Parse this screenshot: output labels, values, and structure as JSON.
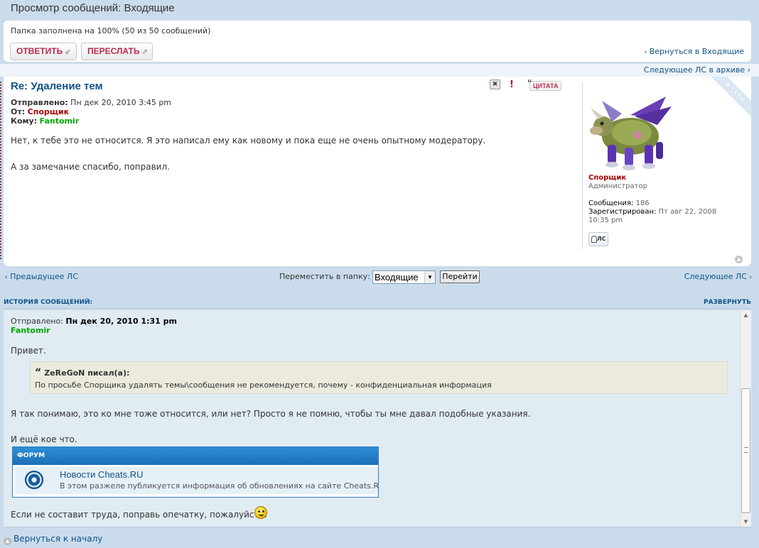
{
  "header": {
    "title": "Просмотр сообщений: Входящие"
  },
  "top_panel": {
    "folder_status": "Папка заполнена на 100% (50 из 50 сообщений)",
    "reply_label": "ОТВЕТИТЬ",
    "forward_label": "ПЕРЕСЛАТЬ",
    "back_arrow": "‹",
    "back_label": "Вернуться в Входящие"
  },
  "archive": {
    "label": "Следующее ЛС в архиве",
    "arrow": "›"
  },
  "message": {
    "subject": "Re: Удаление тем",
    "sent_label": "Отправлено:",
    "sent_value": "Пн дек 20, 2010 3:45 pm",
    "from_label": "От:",
    "from_value": "Спорщик",
    "to_label": "Кому:",
    "to_value": "Fantomir",
    "text1": "Нет, к тебе это не относится. Я это написал ему как новому и пока еще не очень опытному модератору.",
    "text2": "А за замечание спасибо, поправил.",
    "tools": {
      "delete_glyph": "✖",
      "report_glyph": "!",
      "quote_label": "ЦИТАТА",
      "quote_glyph": "“"
    },
    "online_label": "В СЕТИ"
  },
  "profile": {
    "username": "Спорщик",
    "rank": "Администратор",
    "posts_label": "Сообщения:",
    "posts_value": "186",
    "registered_label": "Зарегистрирован:",
    "registered_value": "Пт авг 22, 2008",
    "registered_time": "10:35 pm",
    "pm_label": "ЛС"
  },
  "nav": {
    "prev_label": "Предыдущее ЛС",
    "next_label": "Следующее ЛС",
    "prev_arrow": "‹",
    "next_arrow": "›",
    "move_label": "Переместить в папку:",
    "folder_selected": "Входящие",
    "go_label": "Перейти"
  },
  "history": {
    "title": "ИСТОРИЯ СООБЩЕНИЙ:",
    "expand_label": "РАЗВЕРНУТЬ",
    "sent_label": "Отправлено:",
    "sent_value": "Пн дек 20, 2010 1:31 pm",
    "author": "Fantomir",
    "greeting": "Привет.",
    "quote_author": "ZeReGoN писал(а):",
    "quote_text": "По просьбе Спорщика удалять темы\\сообщения не рекомендуется, почему - конфиденциальная информация",
    "text1": "Я так понимаю, это ко мне тоже относится, или нет? Просто я не помню, чтобы ты мне давал подобные указания.",
    "text2": "И ещё кое что.",
    "embed_header": "ФОРУМ",
    "embed_title": "Новости Cheats.RU",
    "embed_desc": "В этом разжеле публикуется информация об обновлениях на сайте Cheats.RU",
    "text3": "Если не составит труда, поправь опечатку, пожалуйста."
  },
  "footer": {
    "back_to_top": "Вернуться к началу"
  },
  "icons": {
    "top_icon": "▲",
    "scroll_up": "▲",
    "scroll_down": "▼",
    "select_arrow": "▼",
    "reply_glyph": "⇙",
    "forward_glyph": "⇗"
  },
  "colors": {
    "link": "#105289",
    "admin": "#aa0000",
    "member": "#00aa00",
    "button_text": "#bc2a4d",
    "background": "#cadceb",
    "history_bg": "#e1ebf2"
  }
}
